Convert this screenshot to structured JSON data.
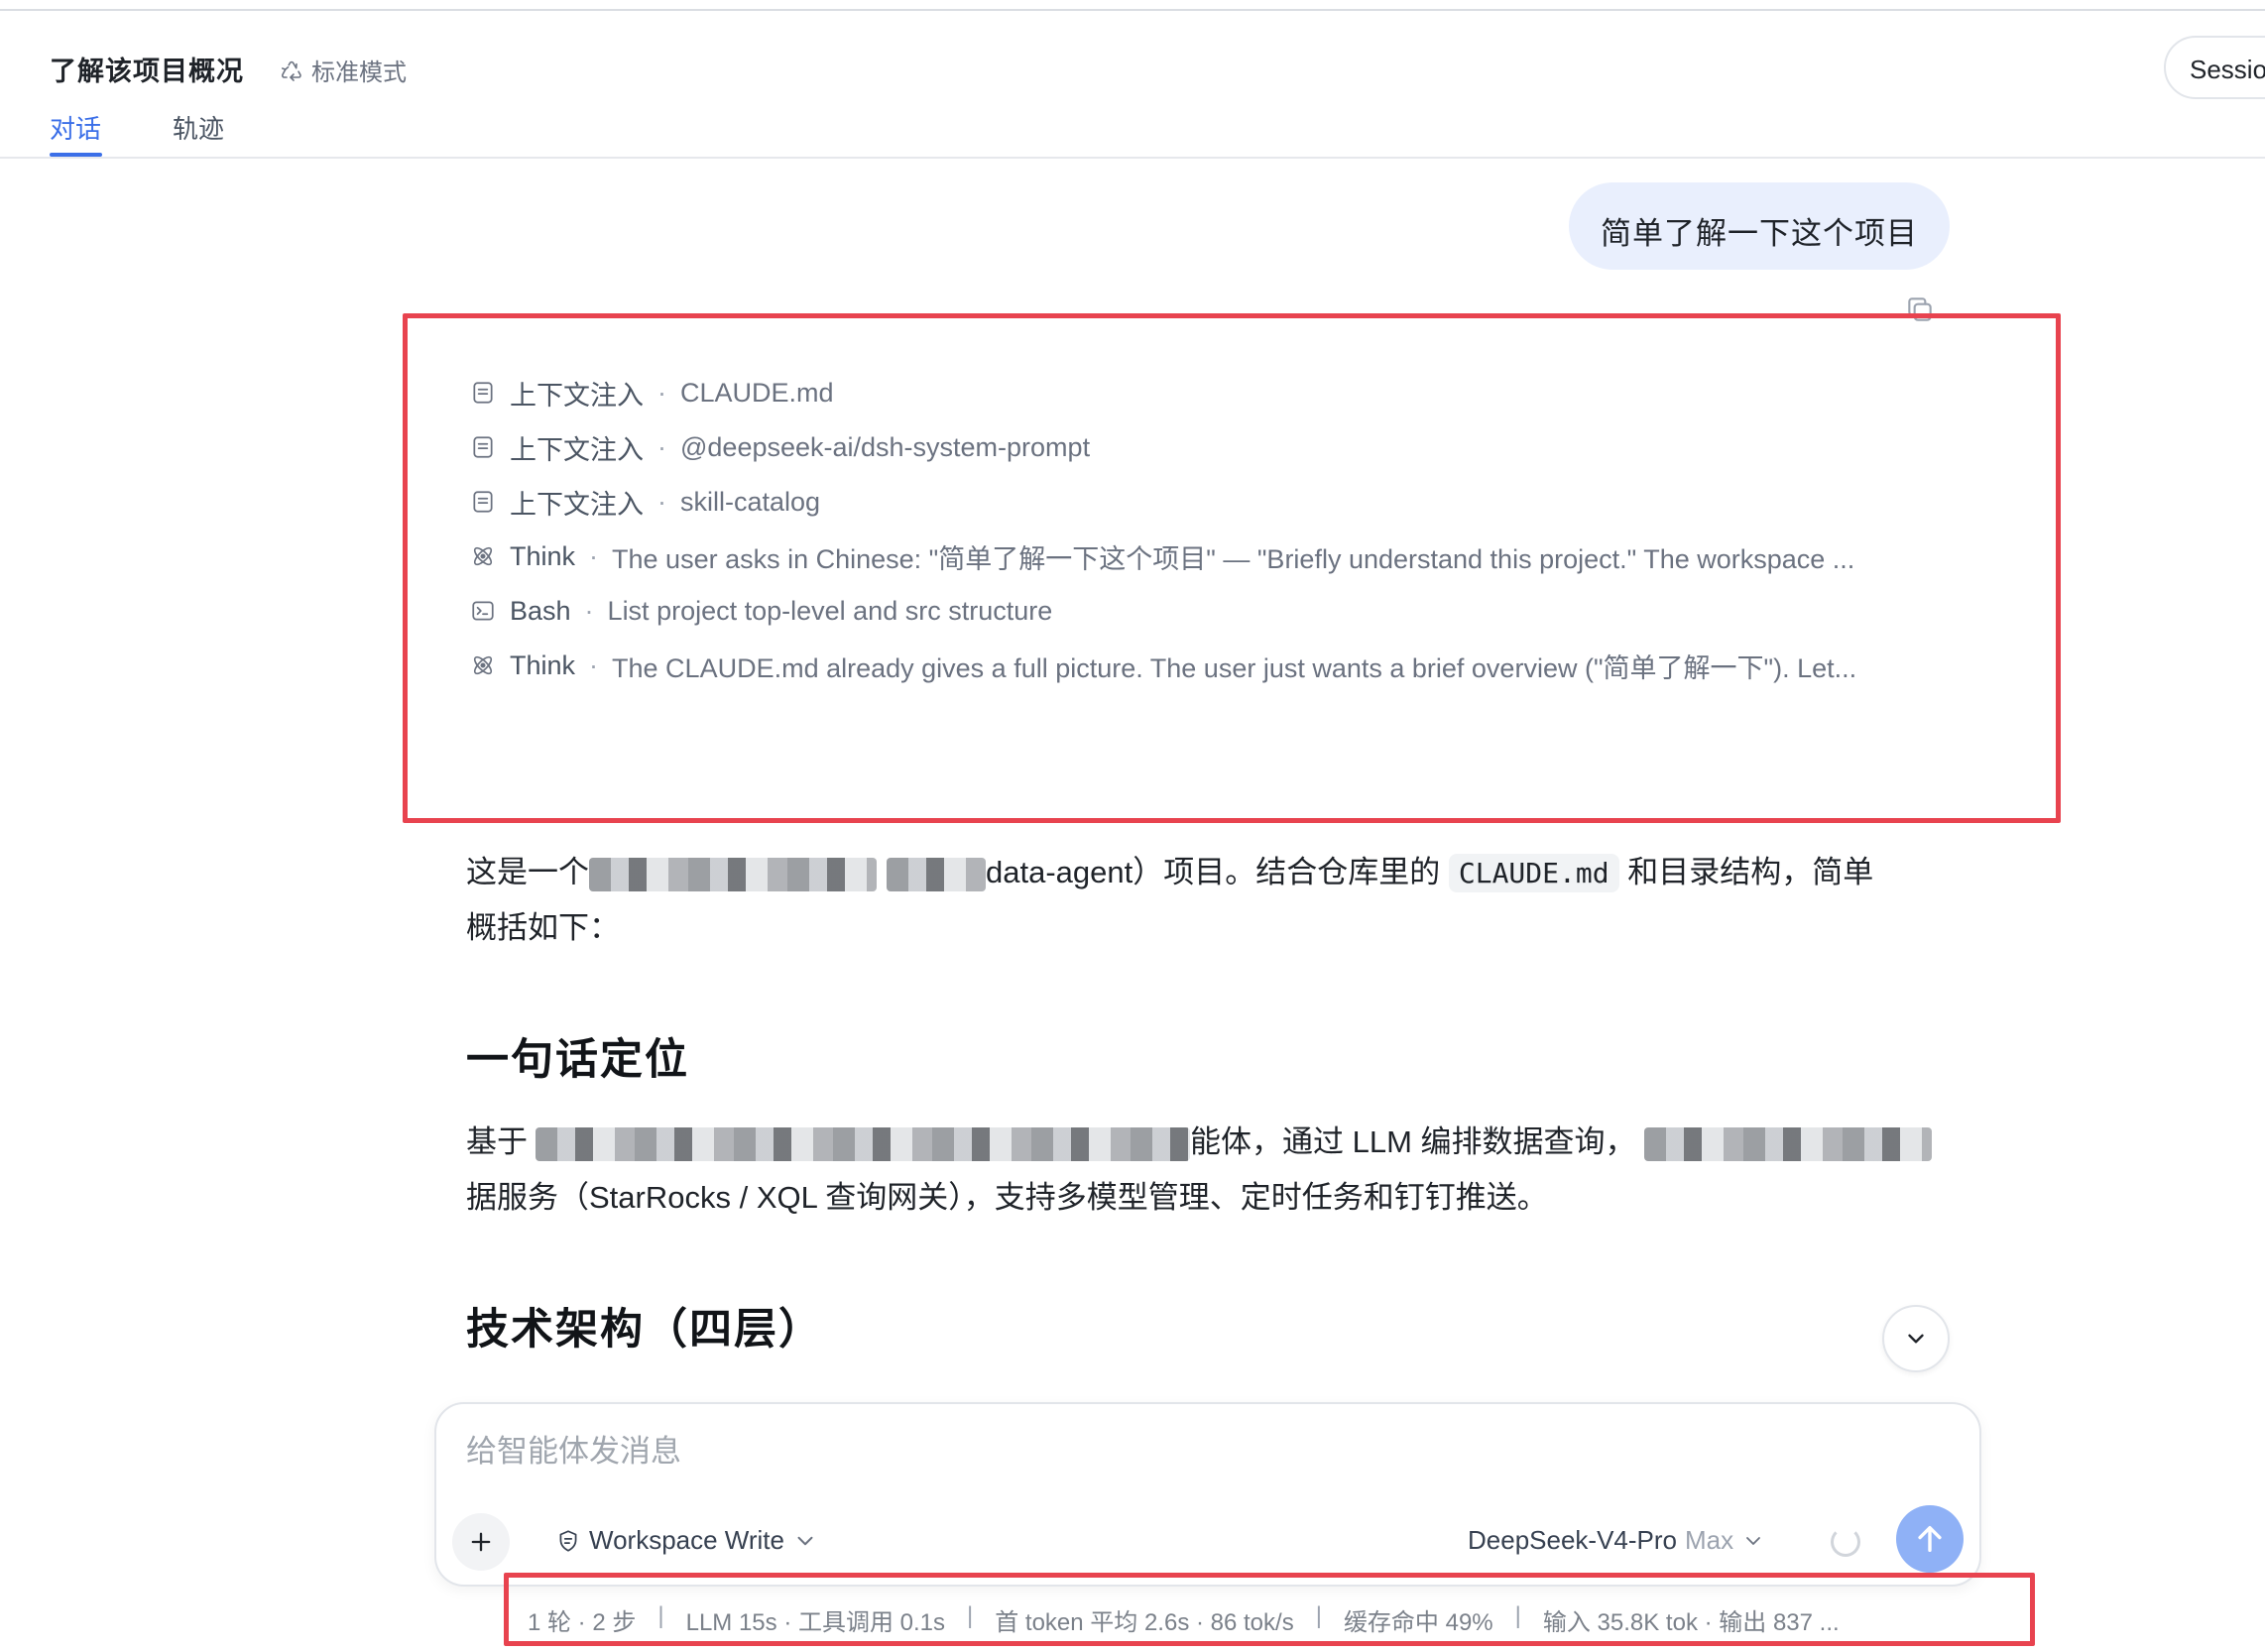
{
  "header": {
    "title": "了解该项目概况",
    "mode_label": "标准模式",
    "session_label": "Sessio",
    "tabs": [
      {
        "label": "对话",
        "active": true
      },
      {
        "label": "轨迹",
        "active": false
      }
    ]
  },
  "user_message": "简单了解一下这个项目",
  "steps": [
    {
      "icon": "document-icon",
      "kind": "上下文注入",
      "detail": "CLAUDE.md"
    },
    {
      "icon": "document-icon",
      "kind": "上下文注入",
      "detail": "@deepseek-ai/dsh-system-prompt"
    },
    {
      "icon": "document-icon",
      "kind": "上下文注入",
      "detail": "skill-catalog"
    },
    {
      "icon": "atom-icon",
      "kind": "Think",
      "detail": "The user asks in Chinese: \"简单了解一下这个项目\" — \"Briefly understand this project.\" The workspace ..."
    },
    {
      "icon": "terminal-icon",
      "kind": "Bash",
      "detail": "List project top-level and src structure"
    },
    {
      "icon": "atom-icon",
      "kind": "Think",
      "detail": "The CLAUDE.md already gives a full picture. The user just wants a brief overview (\"简单了解一下\"). Let..."
    }
  ],
  "step_separator": "·",
  "answer": {
    "intro_prefix": "这是一个",
    "intro_visible": "data-agent）项目。结合仓库里的",
    "intro_code": "CLAUDE.md",
    "intro_suffix": "和目录结构，简单",
    "intro_line2": "概括如下：",
    "heading1": "一句话定位",
    "p1_prefix": "基于",
    "p1_middle": "能体，通过 LLM 编排数据查询，",
    "p1_line2": "据服务（StarRocks / XQL 查询网关），支持多模型管理、定时任务和钉钉推送。",
    "heading2": "技术架构（四层）"
  },
  "composer": {
    "placeholder": "给智能体发消息",
    "permission_label": "Workspace Write",
    "model_label": "DeepSeek-V4-Pro",
    "model_tier": "Max"
  },
  "stats": [
    "1 轮 · 2 步",
    "LLM 15s · 工具调用 0.1s",
    "首 token 平均 2.6s · 86 tok/s",
    "缓存命中 49%",
    "输入 35.8K tok · 输出 837 ..."
  ],
  "stat_separator": "|",
  "colors": {
    "accent": "#3b6fe8",
    "annotation": "#e8434f",
    "bubble": "#e9effd",
    "send_button": "#8fb1f6"
  }
}
